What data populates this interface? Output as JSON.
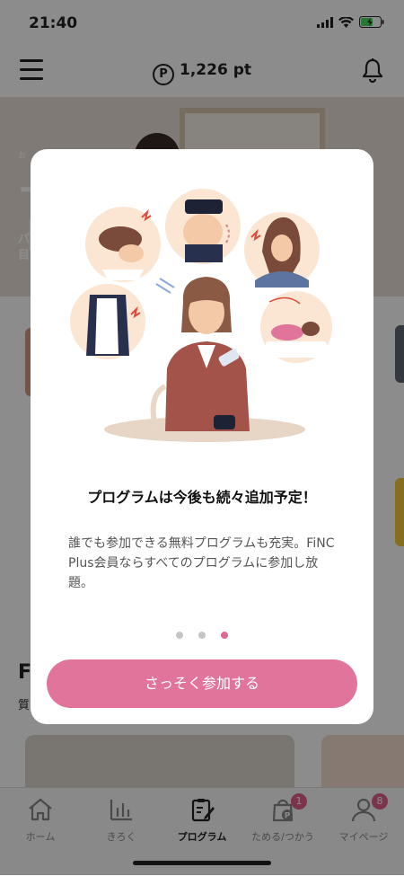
{
  "status": {
    "time": "21:40"
  },
  "header": {
    "point_symbol": "P",
    "points": "1,226 pt"
  },
  "hero": {
    "small_text": "お",
    "big_text": "ー\nト",
    "line1": "パ",
    "line2": "目"
  },
  "section": {
    "title": "F",
    "subtitle": "質"
  },
  "modal": {
    "title": "プログラムは今後も続々追加予定！",
    "description": "誰でも参加できる無料プログラムも充実。FiNC Plus会員ならすべてのプログラムに参加し放題。",
    "pagination": {
      "total": 3,
      "active": 3
    },
    "cta_label": "さっそく参加する"
  },
  "tabbar": {
    "tabs": [
      {
        "label": "ホーム",
        "icon": "home-icon",
        "badge": ""
      },
      {
        "label": "きろく",
        "icon": "chart-icon",
        "badge": ""
      },
      {
        "label": "プログラム",
        "icon": "program-icon",
        "badge": "",
        "active": true
      },
      {
        "label": "ためる/つかう",
        "icon": "points-bag-icon",
        "badge": "1"
      },
      {
        "label": "マイページ",
        "icon": "user-icon",
        "badge": "8"
      }
    ]
  },
  "colors": {
    "accent": "#e0749a",
    "badge": "#e0608a",
    "dot_active": "#e0688f",
    "dot_inactive": "#c5c5c5"
  }
}
